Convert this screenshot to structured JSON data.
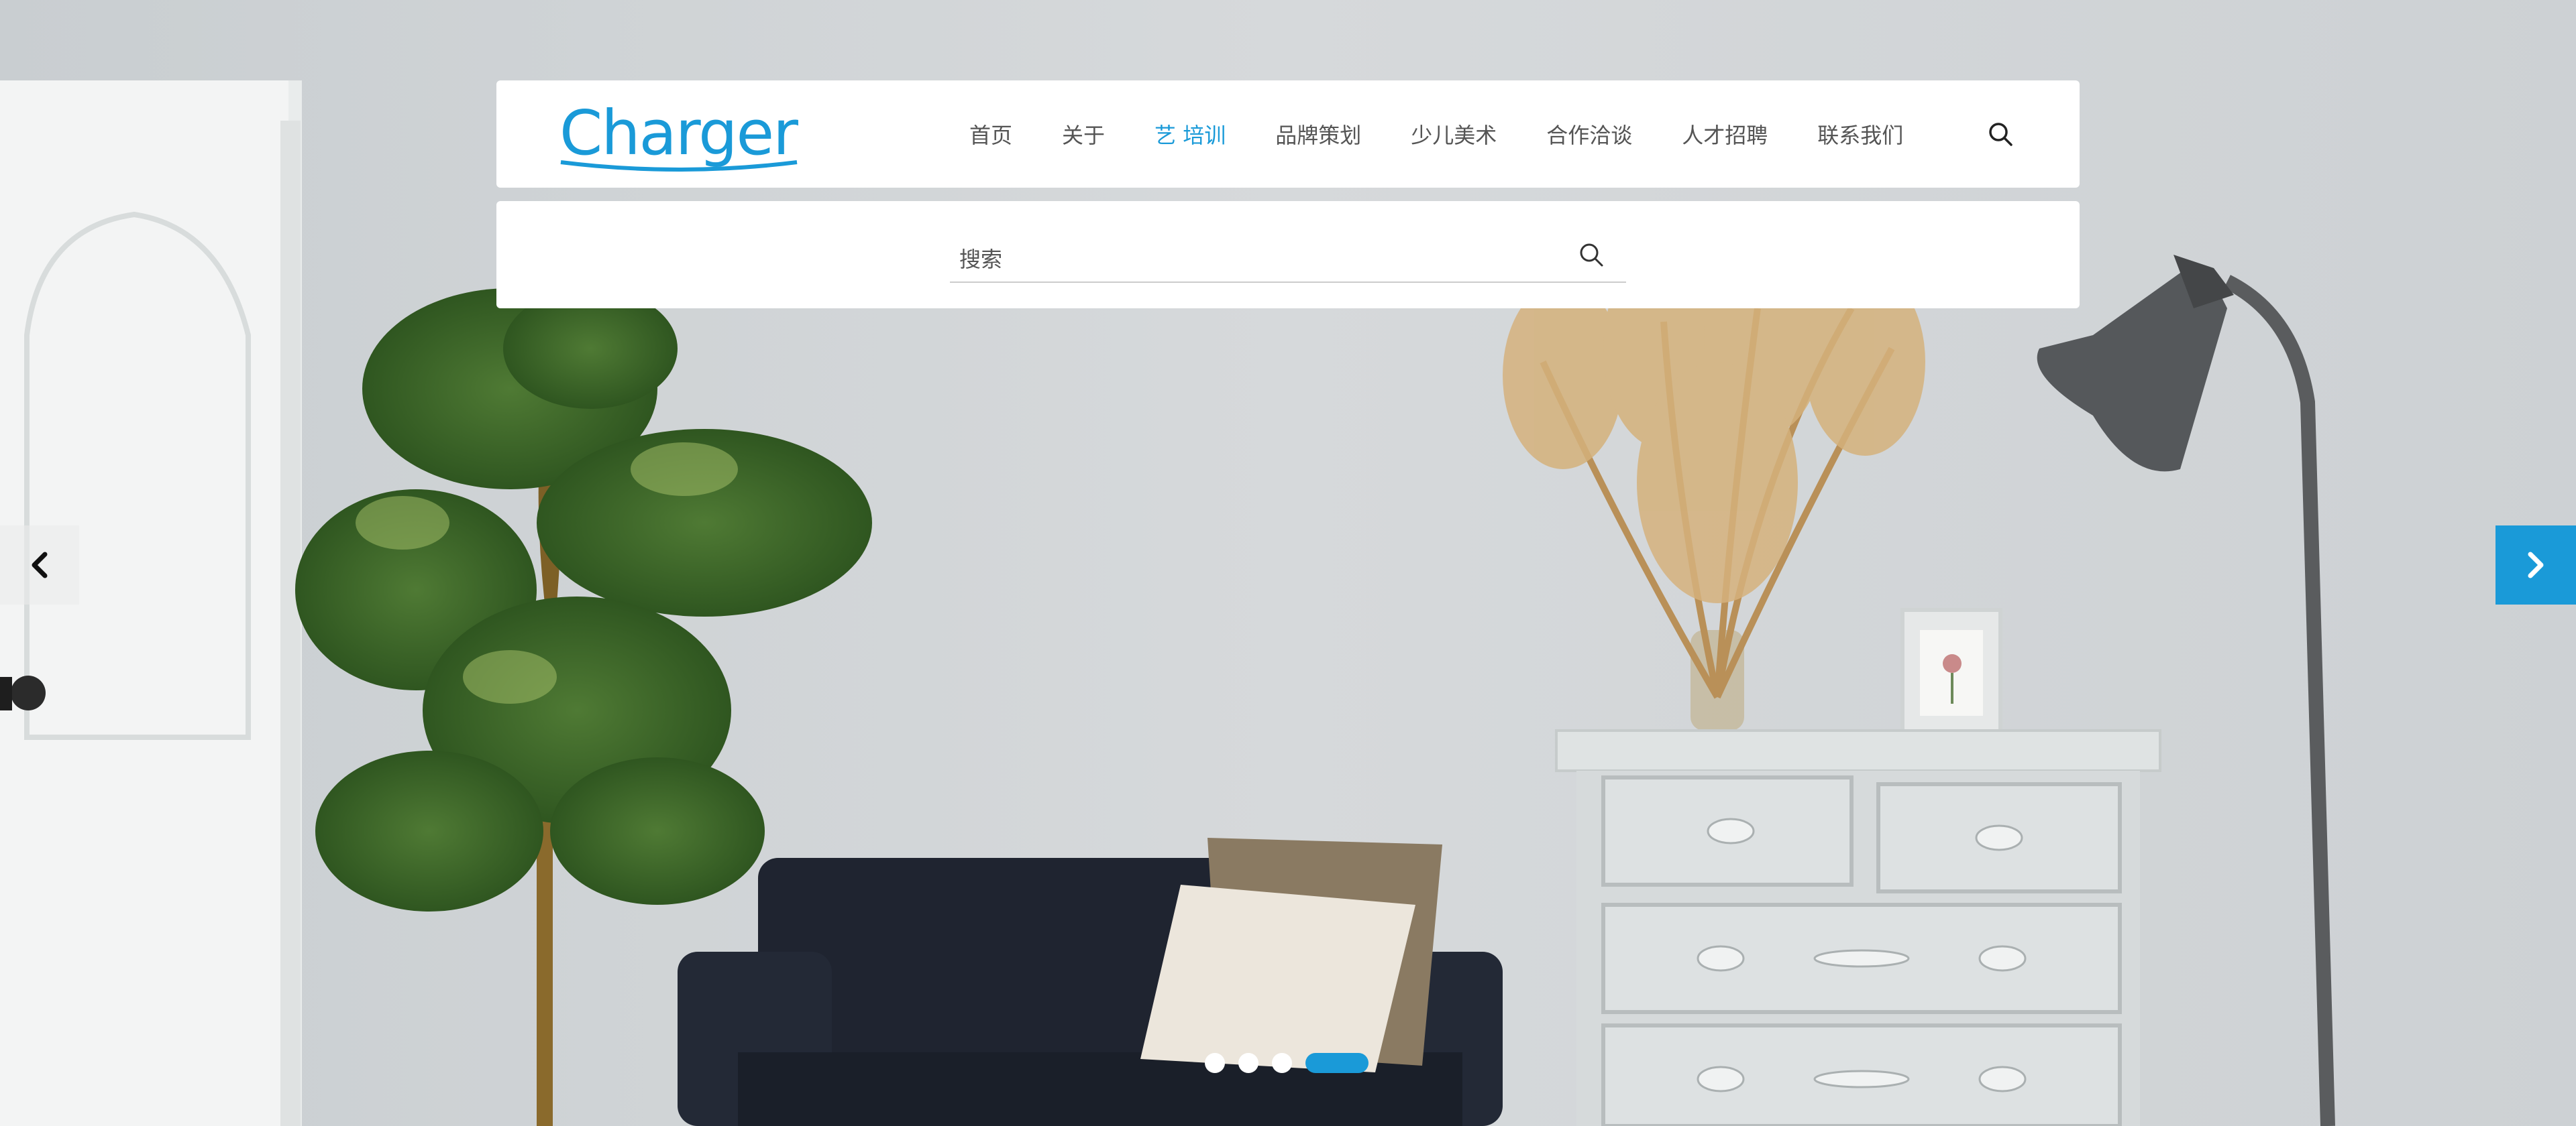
{
  "brand": {
    "logo_text": "Charger",
    "color": "#1a9ad8"
  },
  "nav": {
    "items": [
      {
        "label": "首页"
      },
      {
        "label": "关于"
      },
      {
        "label": "艺 培训",
        "active": true
      },
      {
        "label": "品牌策划"
      },
      {
        "label": "少儿美术"
      },
      {
        "label": "合作洽谈"
      },
      {
        "label": "人才招聘"
      },
      {
        "label": "联系我们"
      }
    ],
    "search_icon": "search-icon"
  },
  "search": {
    "placeholder": "搜索",
    "value": "",
    "icon": "search-icon"
  },
  "slider": {
    "prev_icon": "chevron-left-icon",
    "next_icon": "chevron-right-icon",
    "dot_count": 4,
    "active_index": 3,
    "accent": "#1a9ad8"
  }
}
